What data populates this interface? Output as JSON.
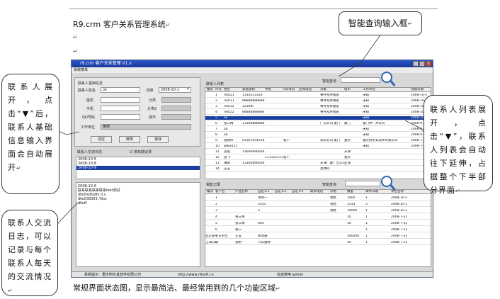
{
  "document": {
    "title": "R9.crm 客户关系管理系统",
    "para_mark": "↵",
    "caption": "常规界面状态图，显示最简洁、最经常用到的几个功能区域"
  },
  "callouts": {
    "search": "智能查询输入框",
    "contact_expand": "联系人展开，点击“▼”后，联系人基础信息输入界面会自动展开",
    "contact_list": "联系人列表展开，点击“▼”，联系人列表会自动往下延伸，占据整个下半部分界面",
    "comm_log": "联系人交流日志，可以记录与每个联系人每天的交流情况"
  },
  "window": {
    "title": "r9.crm 客户关系管理 V1.x",
    "menu": "系统菜单",
    "contact_form": {
      "group_label": "联系人基础信息",
      "name_label": "联系人姓名",
      "name_value": "ok",
      "date_label": "日期",
      "date_value": "2008-10-1",
      "field_labels": [
        "座机",
        "手机",
        "QQ号码",
        "工作单位"
      ],
      "side_labels": [
        "分类",
        "分类2",
        "城市"
      ],
      "unit_value": "某部",
      "buttons": [
        "清空",
        "修改",
        "保存"
      ]
    },
    "log": {
      "header_left": "联系人交流日志",
      "header_right": "按日期记录",
      "dates": [
        "2008-10-5",
        "2008-10-8",
        "2008-10-9"
      ],
      "lines": [
        "2008-10-9",
        "联系联系联系联系test测试",
        "dfsdfsdfsdfs d s",
        "dfsdf3ll3ll3 /hlss",
        "dfsdf"
      ]
    },
    "contact_list": {
      "title": "联系人列表",
      "search_label": "智能查询",
      "headers": [
        "编号",
        "序号",
        "姓名",
        "家庭座机",
        "手机",
        "QQ号码",
        "区域电话",
        "分类",
        "城市",
        "工作单位",
        "创建日期"
      ],
      "rows": [
        [
          "1",
          "Test21",
          "1333333333",
          "",
          "",
          "",
          "事件及终端系",
          "",
          "未知",
          "2008-10-5"
        ],
        [
          "2",
          "Test11",
          "88888888888",
          "",
          "",
          "",
          "事件及终端系",
          "",
          "未知",
          "2008-10-8"
        ],
        [
          "3",
          "Test12",
          "1234f6",
          "",
          "",
          "",
          "事件及终端系",
          "",
          "未知",
          "2008-10-8"
        ],
        [
          "4",
          "Test22",
          "88888888888",
          "",
          "",
          "",
          "事件及终端系",
          "",
          "未知",
          "2008-10-1"
        ],
        [
          "5",
          "ok",
          "",
          "",
          "",
          "",
          "",
          "",
          "未知",
          "2008-10-1"
        ],
        [
          "6",
          "张三梅",
          "13348888888",
          "",
          "",
          "",
          "广东公司 厦门",
          "厦门",
          "厦门中广州公司",
          "2008-9-28"
        ],
        [
          "7",
          "aa",
          "",
          "",
          "",
          "",
          "",
          "",
          "未知",
          "2008-9-29"
        ],
        [
          "8",
          "aa",
          "",
          "",
          "",
          "",
          "",
          "",
          "未知",
          "2008-9-29"
        ],
        [
          "9",
          "张韩伟",
          "02367654518",
          "",
          "客户",
          "",
          "某华公司 厦门",
          "重庆",
          "重庆阿尔其软件有限公司",
          "2008-7-31"
        ],
        [
          "10",
          "www111",
          "",
          "",
          "",
          "",
          "",
          "",
          "未知",
          "2008-7-31"
        ],
        [
          "11",
          "吴绍",
          "13666666666",
          "",
          "",
          "",
          "",
          "天津",
          "",
          ""
        ],
        [
          "12",
          "张飞",
          "",
          "111111111",
          "客户",
          "",
          "",
          "重庆",
          "",
          ""
        ],
        [
          "13",
          "薄阳",
          "13166666666",
          "",
          "",
          "",
          "天津广厦广告公司",
          "上海",
          "",
          ""
        ],
        [
          "14",
          "王五",
          "",
          "",
          "",
          "",
          "具体的",
          "",
          "",
          ""
        ]
      ]
    },
    "sales": {
      "title": "销售记录",
      "search_label": "智能查询",
      "headers": [
        "编号",
        "客户名",
        "产品名称",
        "自定义1",
        "自定义2",
        "自定义3",
        "联系电话",
        "价格",
        "数量",
        "邮件日期",
        "单位名称"
      ],
      "rows": [
        [
          "1",
          "",
          "项目一",
          "",
          "",
          "",
          "销售",
          "1000",
          "1",
          "2008-10-5",
          ""
        ],
        [
          "2",
          "",
          "3333",
          "",
          "",
          "",
          "销售",
          "3333",
          "3",
          "2008-10-1",
          ""
        ],
        [
          "3",
          "",
          "3",
          "",
          "",
          "",
          "销售",
          "10000",
          "1",
          "2008-10-1",
          ""
        ],
        [
          "4",
          "张三梅",
          "",
          "",
          "",
          "",
          "",
          "10",
          "1",
          "2008-7-31",
          ""
        ],
        [
          "5",
          "张三梅",
          "test",
          "",
          "",
          "",
          "",
          "10",
          "1",
          "2008-7-31",
          ""
        ],
        [
          "6",
          "张三",
          "",
          "",
          "",
          "",
          "",
          "",
          "1",
          "2008-7-31",
          ""
        ],
        [
          "7",
          "王五",
          "移动通",
          "",
          "",
          "",
          "",
          "300000",
          "1",
          "2008-7-31",
          "北京某平方单位"
        ],
        [
          "8",
          "张明",
          "汽车维修",
          "",
          "",
          "",
          "",
          "50",
          "1",
          "2008-7-31",
          "上海公司"
        ]
      ]
    },
    "status": {
      "left": "系统提示：重庆阿尔其软件有限公司",
      "mid": "http://www.r9soft.cn",
      "right": "欢迎使用 admin"
    }
  }
}
